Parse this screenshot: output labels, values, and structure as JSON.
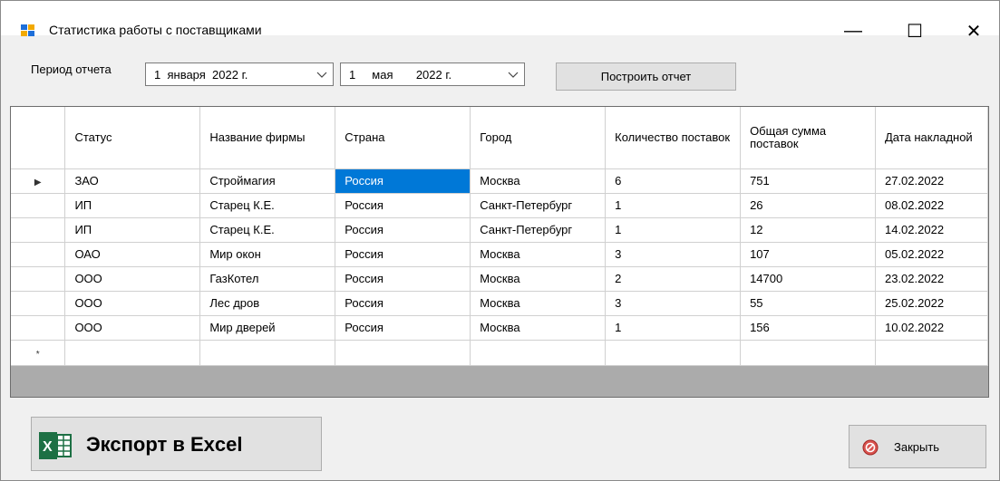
{
  "window": {
    "title": "Статистика работы с поставщиками",
    "controls": {
      "minimize": "—",
      "maximize": "☐",
      "close": "✕"
    },
    "app_icon": "form-icon"
  },
  "filter": {
    "period_label": "Период отчета",
    "from": {
      "day": "1",
      "month": "января",
      "year": "2022 г."
    },
    "to": {
      "day": "1",
      "month": "мая",
      "year": "2022 г."
    },
    "dropdown_icon": "chevron-down-icon"
  },
  "actions": {
    "build_report": "Построить отчет",
    "export_excel": "Экспорт в Excel",
    "close": "Закрыть"
  },
  "table": {
    "columns": [
      "Статус",
      "Название фирмы",
      "Страна",
      "Город",
      "Количество поставок",
      "Общая сумма поставок",
      "Дата накладной"
    ],
    "rows": [
      [
        "ЗАО",
        "Строймагия",
        "Россия",
        "Москва",
        "6",
        "751",
        "27.02.2022"
      ],
      [
        "ИП",
        "Старец К.Е.",
        "Россия",
        "Санкт-Петербург",
        "1",
        "26",
        "08.02.2022"
      ],
      [
        "ИП",
        "Старец К.Е.",
        "Россия",
        "Санкт-Петербург",
        "1",
        "12",
        "14.02.2022"
      ],
      [
        "ОАО",
        "Мир окон",
        "Россия",
        "Москва",
        "3",
        "107",
        "05.02.2022"
      ],
      [
        "ООО",
        "ГазКотел",
        "Россия",
        "Москва",
        "2",
        "14700",
        "23.02.2022"
      ],
      [
        "ООО",
        "Лес дров",
        "Россия",
        "Москва",
        "3",
        "55",
        "25.02.2022"
      ],
      [
        "ООО",
        "Мир дверей",
        "Россия",
        "Москва",
        "1",
        "156",
        "10.02.2022"
      ]
    ],
    "current_row_marker": "▶",
    "new_row_marker": "*",
    "selected_cell": {
      "row": 0,
      "col": 2
    },
    "selection_color": "#0078d7"
  },
  "colors": {
    "window_bg": "#f0f0f0",
    "excel_green": "#1d7044",
    "close_red": "#d9534f"
  }
}
